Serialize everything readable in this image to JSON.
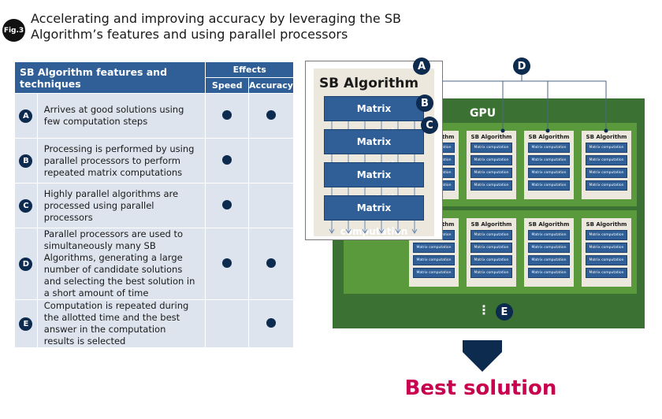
{
  "figure": {
    "badge": "Fig.3",
    "title": "Accelerating and improving accuracy by leveraging the SB Algorithm’s features and using parallel processors"
  },
  "table": {
    "header": "SB Algorithm features and techniques",
    "effects": "Effects",
    "speed": "Speed",
    "accuracy": "Accuracy",
    "rows": [
      {
        "letter": "A",
        "text": "Arrives at good solutions using few computation steps",
        "speed": true,
        "accuracy": true
      },
      {
        "letter": "B",
        "text": "Processing is performed by using parallel processors to perform repeated matrix computations",
        "speed": true,
        "accuracy": false
      },
      {
        "letter": "C",
        "text": "Highly parallel algorithms are processed using parallel processors",
        "speed": true,
        "accuracy": false
      },
      {
        "letter": "D",
        "text": "Parallel processors are used to simultaneously many SB Algorithms, generating a large number of candidate solutions and selecting the best solution in a short amount of time",
        "speed": true,
        "accuracy": true
      },
      {
        "letter": "E",
        "text": "Computation is repeated during the allotted time and the best answer in the computation results is selected",
        "speed": false,
        "accuracy": true
      }
    ]
  },
  "diagram": {
    "gpu": "GPU",
    "algorithm": "SB Algorithm",
    "matrix": "Matrix computation",
    "ellipsis": "⋮",
    "markers": [
      "A",
      "B",
      "C",
      "D",
      "E"
    ],
    "result": "Best solution"
  },
  "colors": {
    "navy": "#0d2a4f",
    "blue": "#2f5f96",
    "gpu": "#3b7233",
    "band": "#5a993c",
    "beige": "#ece8dd",
    "result": "#c8004f"
  }
}
